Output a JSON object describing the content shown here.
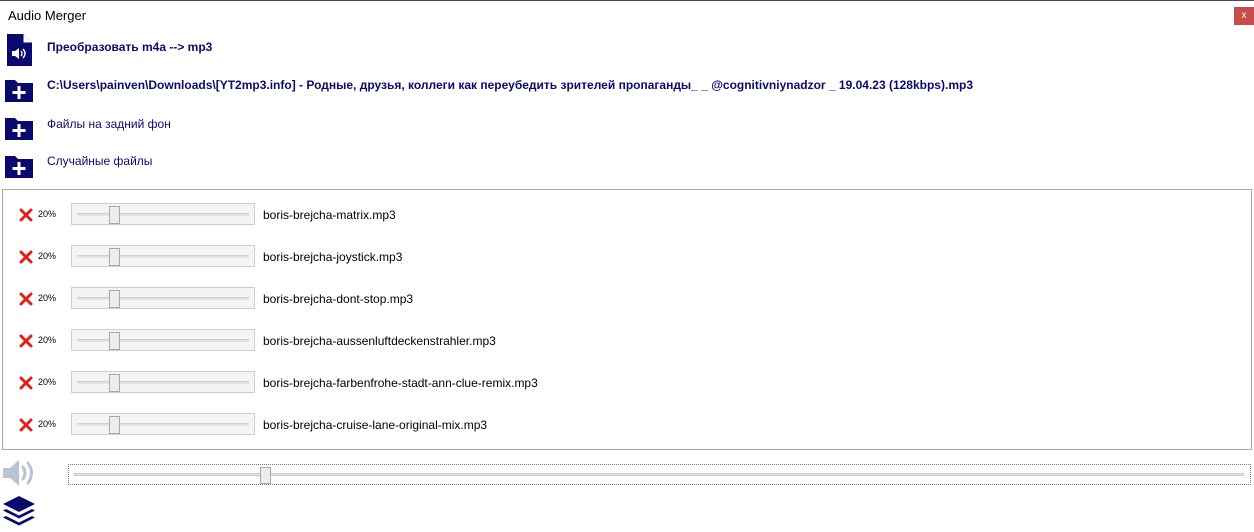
{
  "window": {
    "title": "Audio Merger",
    "close_label": "x"
  },
  "actions": {
    "convert": {
      "label": "Преобразовать m4a --> mp3",
      "icon": "audio-file-icon"
    },
    "main_file": {
      "label": "C:\\Users\\painven\\Downloads\\[YT2mp3.info] - Родные, друзья, коллеги как переубедить зрителей пропаганды_ _ @cognitivniynadzor _ 19.04.23 (128kbps).mp3",
      "icon": "folder-add-icon"
    },
    "background_files": {
      "label": "Файлы на задний фон",
      "icon": "folder-add-icon"
    },
    "random_files": {
      "label": "Случайные файлы",
      "icon": "folder-add-icon"
    }
  },
  "tracks": [
    {
      "volume": "20%",
      "volume_fraction": 0.2,
      "name": "boris-brejcha-matrix.mp3"
    },
    {
      "volume": "20%",
      "volume_fraction": 0.2,
      "name": "boris-brejcha-joystick.mp3"
    },
    {
      "volume": "20%",
      "volume_fraction": 0.2,
      "name": "boris-brejcha-dont-stop.mp3"
    },
    {
      "volume": "20%",
      "volume_fraction": 0.2,
      "name": "boris-brejcha-aussenluftdeckenstrahler.mp3"
    },
    {
      "volume": "20%",
      "volume_fraction": 0.2,
      "name": "boris-brejcha-farbenfrohe-stadt-ann-clue-remix.mp3"
    },
    {
      "volume": "20%",
      "volume_fraction": 0.2,
      "name": "boris-brejcha-cruise-lane-original-mix.mp3"
    }
  ],
  "master": {
    "volume_fraction": 0.16,
    "icon": "speaker-icon"
  },
  "footer": {
    "icon": "layers-icon"
  },
  "colors": {
    "accent": "#0a0a6e",
    "close": "#c94c4c",
    "delete": "#e0211b",
    "speaker": "#b9c3d6"
  }
}
